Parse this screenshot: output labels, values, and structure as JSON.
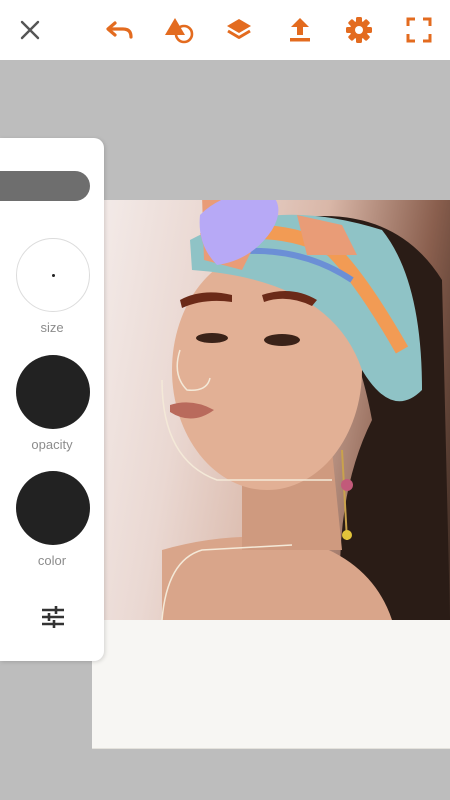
{
  "toolbar": {
    "accent_color": "#e36b1f",
    "icons": [
      "close-icon",
      "undo-icon",
      "shapes-icon",
      "layers-icon",
      "upload-icon",
      "gear-icon",
      "fullscreen-icon"
    ]
  },
  "panel": {
    "size_label": "size",
    "opacity_label": "opacity",
    "color_label": "color",
    "opacity_value": "#222222",
    "color_value": "#222222",
    "adjust_icon": "sliders-icon"
  },
  "colors": {
    "canvas_bg": "#bdbdbd",
    "artboard": "#f7f6f3",
    "paint_lavender": "#b7a9f6",
    "paint_salmon": "#e99c77",
    "paint_brown": "#6b2a18"
  }
}
